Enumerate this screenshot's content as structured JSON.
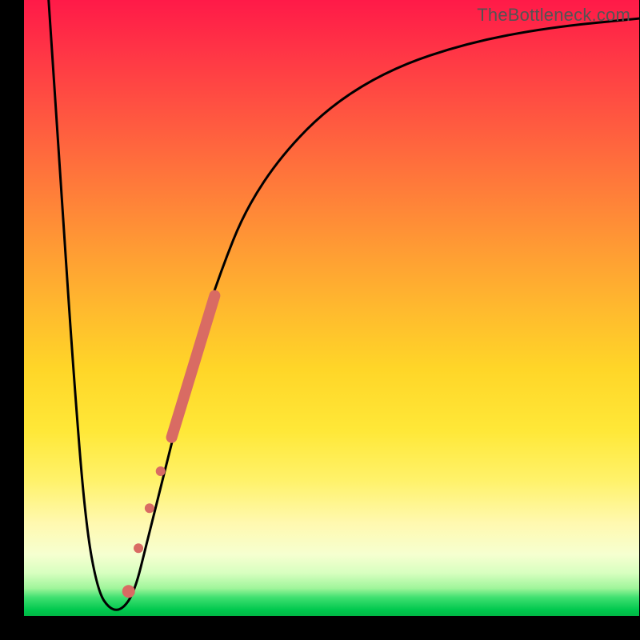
{
  "watermark": "TheBottleneck.com",
  "colors": {
    "page_bg": "#000000",
    "curve": "#000000",
    "marker_fill": "#d96b63",
    "marker_stroke": "#d96b63"
  },
  "chart_data": {
    "type": "line",
    "title": "",
    "xlabel": "",
    "ylabel": "",
    "xlim": [
      0,
      100
    ],
    "ylim": [
      0,
      100
    ],
    "grid": false,
    "legend": false,
    "series": [
      {
        "name": "v-curve",
        "x": [
          4,
          6,
          8,
          10,
          12,
          14,
          16,
          18,
          20,
          22,
          25,
          28,
          32,
          36,
          42,
          50,
          60,
          72,
          85,
          100
        ],
        "y": [
          100,
          70,
          40,
          15,
          4,
          1,
          1,
          4,
          12,
          20,
          32,
          44,
          56,
          66,
          75,
          83,
          89,
          93,
          95.5,
          97
        ],
        "color": "#000000"
      }
    ],
    "markers": [
      {
        "shape": "thick-segment",
        "x0": 24,
        "y0": 29,
        "x1": 31,
        "y1": 52,
        "width": 14
      },
      {
        "shape": "circle",
        "cx": 22.2,
        "cy": 23.5,
        "r": 6
      },
      {
        "shape": "circle",
        "cx": 20.4,
        "cy": 17.5,
        "r": 6
      },
      {
        "shape": "circle",
        "cx": 18.6,
        "cy": 11.0,
        "r": 6
      },
      {
        "shape": "circle",
        "cx": 17.0,
        "cy": 4.0,
        "r": 8
      }
    ],
    "note": "x and y are in percent of plot area (0–100). Gradient background red→green top→bottom."
  }
}
